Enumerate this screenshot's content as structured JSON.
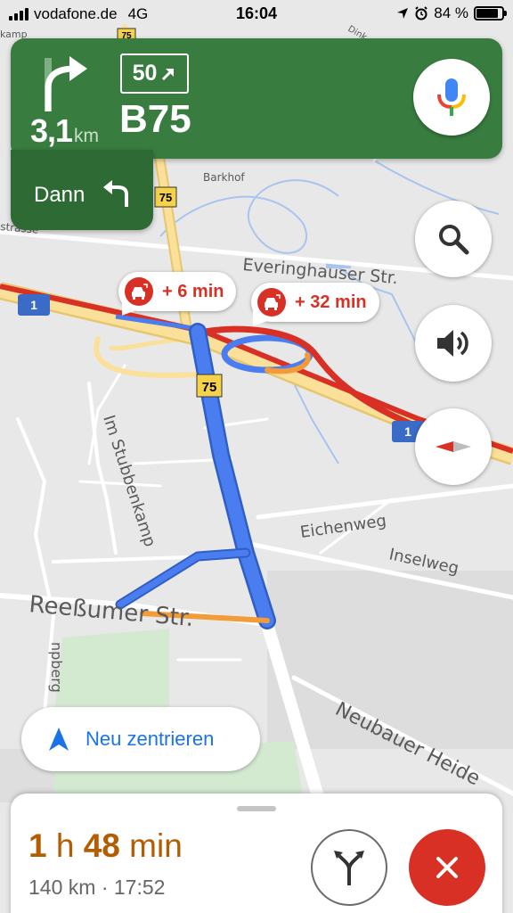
{
  "status_bar": {
    "carrier": "vodafone.de",
    "network": "4G",
    "time": "16:04",
    "battery_percent": "84 %",
    "battery_level": 0.84,
    "icons": [
      "signal-bars-icon",
      "location-arrow-icon",
      "alarm-icon",
      "battery-icon"
    ]
  },
  "navigation": {
    "distance_value": "3,1",
    "distance_unit": "km",
    "speed_limit": "50",
    "road_name": "B75",
    "then_label": "Dann",
    "turn_icon": "turn-right-icon",
    "then_icon": "turn-left-icon",
    "card_color": "#387d3f"
  },
  "map": {
    "labels": {
      "everinghauser": "Everinghauser Str.",
      "im_stubbenkamp": "Im Stubbenkamp",
      "eichenweg": "Eichenweg",
      "inselweg": "Inselweg",
      "reessumer": "Reeßumer Str.",
      "neubauer": "Neubauer Heide",
      "barkhof": "Barkhof",
      "pberg": "npberg",
      "kamp": "kamp",
      "strasse": "strasse",
      "dink": "Dink"
    },
    "shields": {
      "b75_top": "75",
      "b75_upper": "75",
      "b75_main": "75",
      "a1_left": "1",
      "a1_right": "1"
    },
    "route_color": "#4a7df0",
    "traffic_colors": {
      "heavy": "#d93025",
      "moderate": "#f29b38"
    }
  },
  "delays": [
    {
      "text": "+ 6 min"
    },
    {
      "text": "+ 32 min"
    }
  ],
  "controls": {
    "search": "search-icon",
    "sound": "volume-icon",
    "compass": "compass-icon",
    "mic": "microphone-icon"
  },
  "recenter": {
    "label": "Neu zentrieren"
  },
  "bottom_sheet": {
    "duration_hours": "1",
    "duration_h_unit": "h",
    "duration_minutes": "48",
    "duration_min_unit": "min",
    "distance_total": "140 km",
    "separator": "·",
    "arrival_time": "17:52",
    "eta_color": "#b35c00"
  }
}
